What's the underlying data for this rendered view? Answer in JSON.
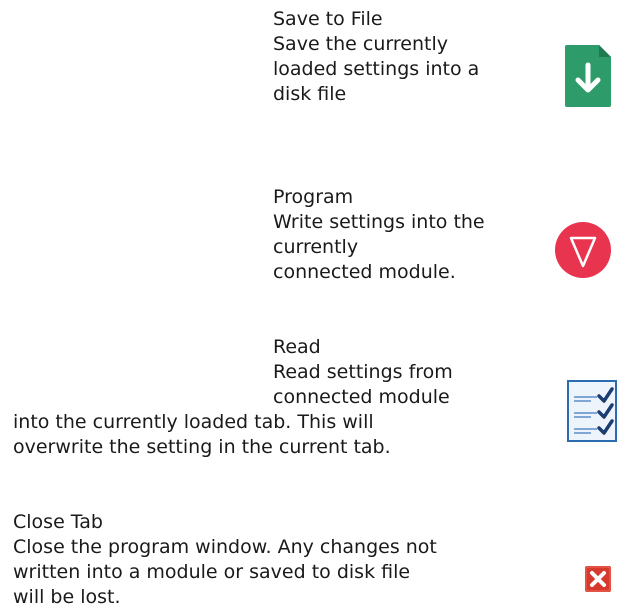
{
  "save": {
    "title": "Save to File",
    "desc": [
      "Save the currently",
      "loaded settings into a",
      "disk file"
    ],
    "icon": "save-download-icon",
    "color": "#2E9C6A"
  },
  "program": {
    "title": "Program",
    "desc": [
      "Write settings into the",
      "currently",
      "connected module."
    ],
    "icon": "program-triangle-icon",
    "color": "#E8344E"
  },
  "read": {
    "title": "Read",
    "desc_top": [
      "Read settings from",
      "connected module"
    ],
    "desc_bottom": [
      "into the currently loaded tab.  This will",
      "overwrite the setting in the current tab."
    ],
    "icon": "read-checklist-icon",
    "color": "#2B6BB0"
  },
  "close": {
    "title": "Close Tab",
    "desc": [
      "Close the program window.  Any changes not",
      "written into a module or saved to disk file",
      "will be lost."
    ],
    "icon": "close-x-icon",
    "color": "#D63A2E"
  }
}
